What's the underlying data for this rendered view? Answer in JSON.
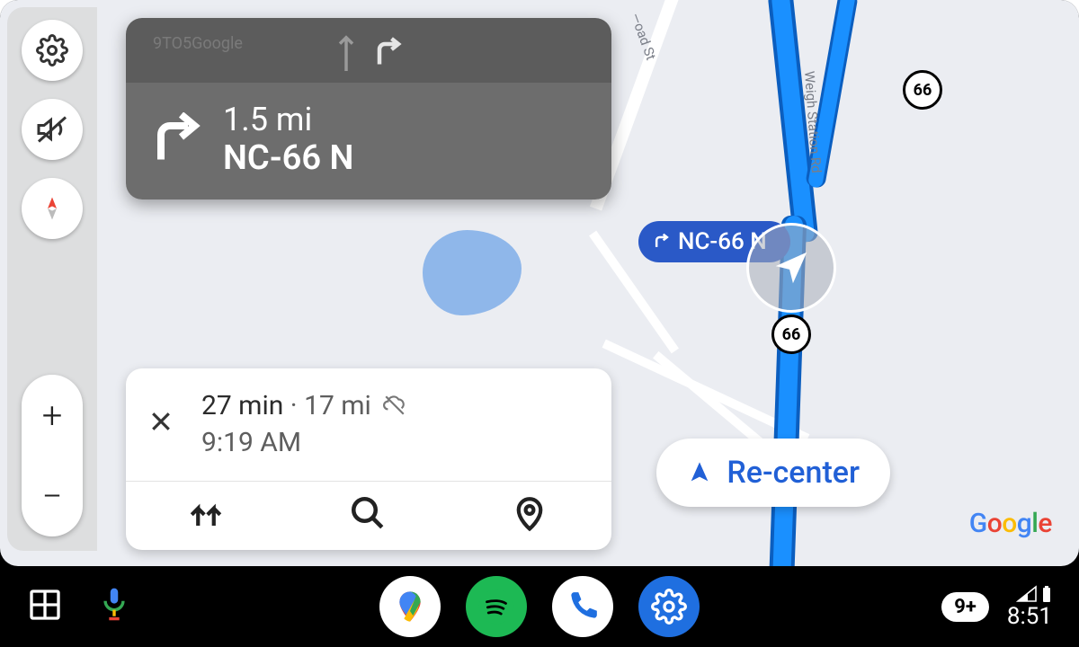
{
  "navigation": {
    "watermark": "9TO5Google",
    "distance": "1.5 mi",
    "road": "NC-66 N",
    "route_pill": "NC-66 N"
  },
  "eta": {
    "duration": "27 min",
    "distance": "17 mi",
    "arrival": "9:19 AM"
  },
  "recenter_label": "Re-center",
  "map": {
    "roads": {
      "label1": "Weigh Station Rd",
      "label2": "—oad St"
    },
    "shields": [
      "66",
      "66"
    ]
  },
  "attribution": "Google",
  "bottom_bar": {
    "notification_count": "9+",
    "clock": "8:51"
  }
}
